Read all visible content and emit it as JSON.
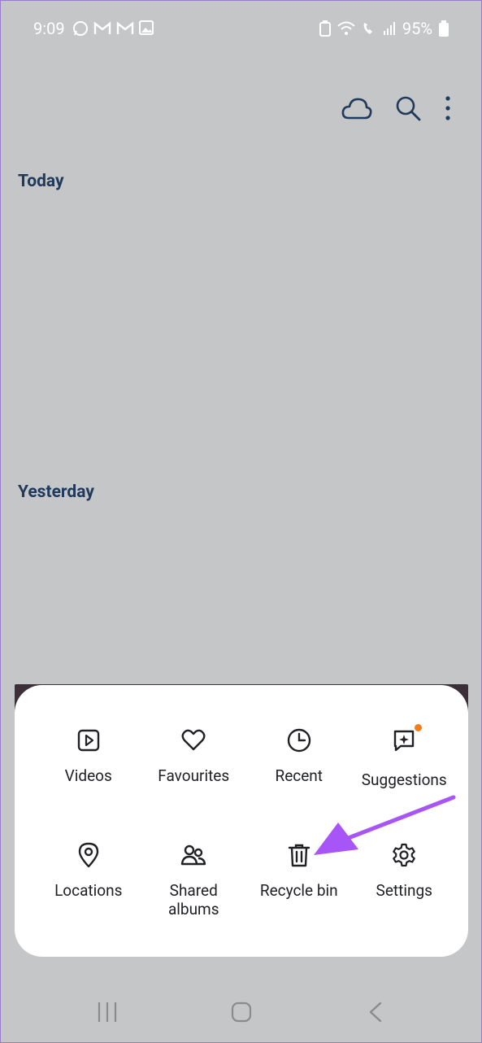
{
  "status_bar": {
    "time": "9:09",
    "battery": "95%"
  },
  "toolbar": {
    "icons": [
      "cloud-icon",
      "search-icon",
      "more-vert-icon"
    ]
  },
  "sections": {
    "today": "Today",
    "yesterday": "Yesterday"
  },
  "menu": {
    "items": [
      {
        "label": "Videos",
        "icon": "video-icon"
      },
      {
        "label": "Favourites",
        "icon": "heart-icon"
      },
      {
        "label": "Recent",
        "icon": "clock-icon"
      },
      {
        "label": "Suggestions",
        "icon": "suggestions-icon"
      },
      {
        "label": "Locations",
        "icon": "location-pin-icon"
      },
      {
        "label": "Shared\nalbums",
        "icon": "shared-albums-icon"
      },
      {
        "label": "Recycle bin",
        "icon": "trash-icon"
      },
      {
        "label": "Settings",
        "icon": "gear-icon"
      }
    ]
  },
  "colors": {
    "annotation_arrow": "#a855f7",
    "badge": "#f07c1d",
    "section_title": "#203a5c"
  }
}
